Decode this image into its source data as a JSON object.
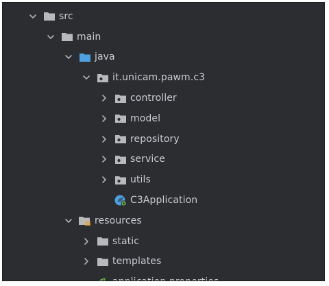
{
  "project_tree": {
    "items": [
      {
        "label": "src",
        "depth": 0,
        "expanded": true,
        "icon": "folder-icon"
      },
      {
        "label": "main",
        "depth": 1,
        "expanded": true,
        "icon": "folder-icon"
      },
      {
        "label": "java",
        "depth": 2,
        "expanded": true,
        "icon": "source-folder-icon"
      },
      {
        "label": "it.unicam.pawm.c3",
        "depth": 3,
        "expanded": true,
        "icon": "package-icon"
      },
      {
        "label": "controller",
        "depth": 4,
        "expanded": false,
        "icon": "package-icon"
      },
      {
        "label": "model",
        "depth": 4,
        "expanded": false,
        "icon": "package-icon"
      },
      {
        "label": "repository",
        "depth": 4,
        "expanded": false,
        "icon": "package-icon"
      },
      {
        "label": "service",
        "depth": 4,
        "expanded": false,
        "icon": "package-icon"
      },
      {
        "label": "utils",
        "depth": 4,
        "expanded": false,
        "icon": "package-icon"
      },
      {
        "label": "C3Application",
        "depth": 4,
        "expanded": null,
        "icon": "spring-boot-class-icon"
      },
      {
        "label": "resources",
        "depth": 2,
        "expanded": true,
        "icon": "resources-folder-icon"
      },
      {
        "label": "static",
        "depth": 3,
        "expanded": false,
        "icon": "folder-icon"
      },
      {
        "label": "templates",
        "depth": 3,
        "expanded": false,
        "icon": "folder-icon"
      },
      {
        "label": "application.properties",
        "depth": 3,
        "expanded": null,
        "icon": "spring-properties-icon"
      }
    ]
  },
  "colors": {
    "background": "#2b2d30",
    "text": "#c9ccd1",
    "folder": "#b7b9bd",
    "source_folder": "#4ea1e0",
    "spring_green": "#6ab04c",
    "chevron": "#aeb1b6"
  }
}
